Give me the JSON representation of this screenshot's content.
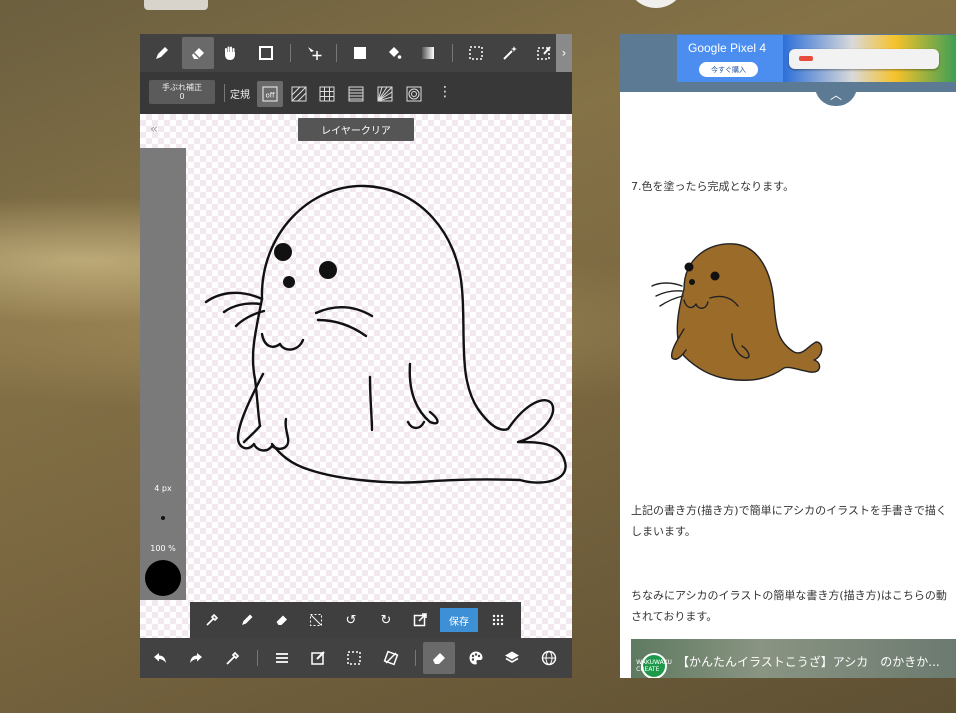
{
  "app": {
    "stabilizer": {
      "label": "手ぶれ補正",
      "value": "0"
    },
    "ruler_label": "定規",
    "ruler_off": "off",
    "toast": "レイヤークリア",
    "sidebar": {
      "brush_size": "4 px",
      "opacity": "100 %"
    },
    "save_label": "保存",
    "top_tools": [
      "pen-icon",
      "eraser-icon",
      "hand-icon",
      "rectangle-icon",
      "move-icon",
      "fill-rect-icon",
      "bucket-icon",
      "gradient-icon",
      "selection-icon",
      "magic-wand-icon",
      "edit-selection-icon"
    ],
    "bottom_tools": [
      "undo-icon",
      "redo-icon",
      "eyedropper-icon",
      "menu-icon",
      "edit-icon",
      "selection-icon",
      "transform-icon",
      "eraser-icon",
      "palette-icon",
      "layers-icon",
      "globe-icon"
    ],
    "colors": {
      "toolbar": "#424242",
      "save": "#3d8fd6"
    }
  },
  "browser": {
    "ad": {
      "brand": "Google Pixel 4",
      "cta": "今すぐ購入"
    },
    "step_text": "7.色を塗ったら完成となります。",
    "para1_line1": "上記の書き方(描き方)で簡単にアシカのイラストを手書きで描く",
    "para1_line2": "しまいます。",
    "para2_line1": "ちなみにアシカのイラストの簡単な書き方(描き方)はこちらの動",
    "para2_line2": "されております。",
    "video": {
      "title": "【かんたんイラストこうざ】アシカ　のかきか...",
      "channel_badge": "WAKUWAKU CREATE"
    }
  }
}
